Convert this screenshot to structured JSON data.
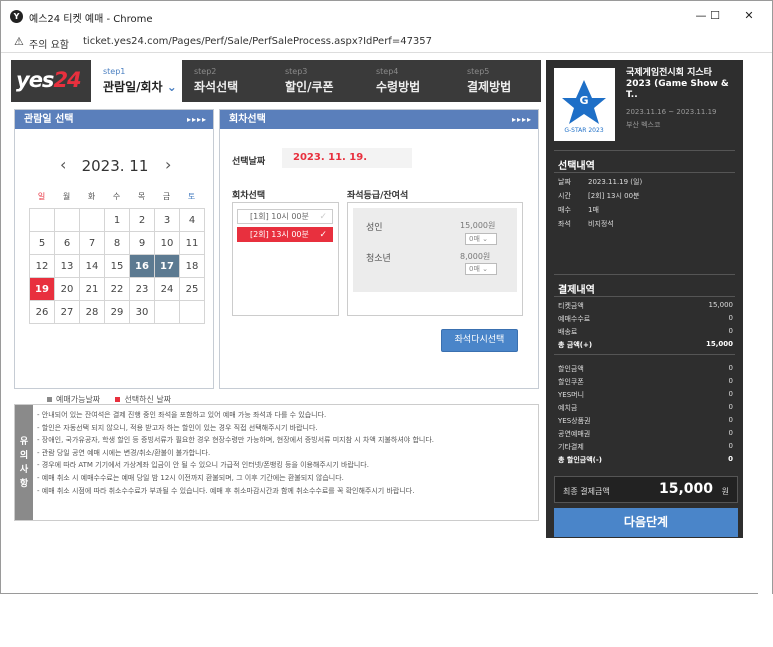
{
  "window": {
    "title": "예스24 티켓 예매 - Chrome",
    "app_icon": "Y",
    "minimize": "—",
    "maximize": "☐",
    "close": "✕"
  },
  "urlbar": {
    "warning": "주의 요함",
    "url": "ticket.yes24.com/Pages/Perf/Sale/PerfSaleProcess.aspx?IdPerf=47357"
  },
  "logo": {
    "text": "yes",
    "num": "24"
  },
  "steps": [
    {
      "num": "step1",
      "label": "관람일/회차",
      "active": true
    },
    {
      "num": "step2",
      "label": "좌석선택"
    },
    {
      "num": "step3",
      "label": "할인/쿠폰"
    },
    {
      "num": "step4",
      "label": "수령방법"
    },
    {
      "num": "step5",
      "label": "결제방법"
    }
  ],
  "date_panel": {
    "title": "관람일 선택",
    "arrows": "▸▸▸▸",
    "month": "2023. 11",
    "prev": "‹",
    "next": "›",
    "weekdays": [
      "일",
      "월",
      "화",
      "수",
      "목",
      "금",
      "토"
    ],
    "weekday_colors": [
      "#e8303e",
      "#555",
      "#555",
      "#555",
      "#555",
      "#555",
      "#4a7fc1"
    ],
    "weeks": [
      [
        "",
        "",
        "",
        "1",
        "2",
        "3",
        "4"
      ],
      [
        "5",
        "6",
        "7",
        "8",
        "9",
        "10",
        "11"
      ],
      [
        "12",
        "13",
        "14",
        "15",
        "16",
        "17",
        "18"
      ],
      [
        "19",
        "20",
        "21",
        "22",
        "23",
        "24",
        "25"
      ],
      [
        "26",
        "27",
        "28",
        "29",
        "30",
        "",
        ""
      ]
    ],
    "available": [
      "16",
      "17"
    ],
    "selected": "19",
    "legend_available": "예매가능날짜",
    "legend_selected": "선택하신 날짜",
    "legend_available_color": "#5c7a91",
    "legend_selected_color": "#e8303e"
  },
  "round_panel": {
    "title": "회차선택",
    "arrows": "▸▸▸▸",
    "selected_date_label": "선택날짜",
    "selected_date": "2023. 11. 19.",
    "round_label": "회차선택",
    "seat_label": "좌석등급/잔여석",
    "rounds": [
      {
        "label": "[1회] 10시 00분",
        "active": false
      },
      {
        "label": "[2회] 13시 00분",
        "active": true
      }
    ],
    "check": "✓",
    "grades": [
      {
        "name": "성인",
        "price": "15,000원",
        "qty": "0매"
      },
      {
        "name": "청소년",
        "price": "8,000원",
        "qty": "0매"
      }
    ],
    "reselect": "좌석다시선택"
  },
  "notice": {
    "tab": [
      "유",
      "의",
      "사",
      "항"
    ],
    "lines": [
      "- 안내되어 있는 잔여석은 결제 진행 중인 좌석을 포함하고 있어 예매 가능 좌석과 다를 수 있습니다.",
      "- 할인은 자동선택 되지 않으니, 적용 받고자 하는 할인이 있는 경우 직접 선택해주시기 바랍니다.",
      "- 장애인, 국가유공자, 학생 할인 등 증빙서류가 필요한 경우 현장수령만 가능하며, 현장에서 증빙서류 미지참 시 차액 지불하셔야 합니다.",
      "- 관람 당일 공연 예매 시에는 변경/취소/환불이 불가합니다.",
      "- 경우에 따라 ATM 기기에서 가상계좌 입금이 안 될 수 있으니 가급적 인터넷/폰뱅킹 등을 이용해주시기 바랍니다.",
      "- 예매 취소 시 예매수수료는 예매 당일 밤 12시 이전까지 환불되며, 그 이후 기간에는 환불되지 않습니다.",
      "- 예매 취소 시점에 따라 취소수수료가 부과될 수 있습니다. 예매 후 취소마감시간과 함께 취소수수료를 꼭 확인해주시기 바랍니다."
    ]
  },
  "sidebar": {
    "poster_text": "G-STAR 2023",
    "event_title": "국제게임전시회 지스타 2023 (Game Show & T..",
    "event_date": "2023.11.16 ~ 2023.11.19",
    "event_venue": "부산 벡스코",
    "selection_title": "선택내역",
    "selection": [
      {
        "k": "날짜",
        "v": "2023.11.19 (일)"
      },
      {
        "k": "시간",
        "v": "[2회] 13시 00분"
      },
      {
        "k": "매수",
        "v": "1매"
      },
      {
        "k": "좌석",
        "v": "비지정석"
      }
    ],
    "payment_title": "결제내역",
    "payment": [
      {
        "k": "티켓금액",
        "v": "15,000"
      },
      {
        "k": "예매수수료",
        "v": "0"
      },
      {
        "k": "배송료",
        "v": "0"
      },
      {
        "k": "총 금액(+)",
        "v": "15,000",
        "bold": true
      }
    ],
    "discount": [
      {
        "k": "할인금액",
        "v": "0"
      },
      {
        "k": "할인쿠폰",
        "v": "0"
      },
      {
        "k": "YES머니",
        "v": "0"
      },
      {
        "k": "예치금",
        "v": "0"
      },
      {
        "k": "YES상품권",
        "v": "0"
      },
      {
        "k": "공연예매권",
        "v": "0"
      },
      {
        "k": "기타결제",
        "v": "0"
      },
      {
        "k": "총 할인금액(-)",
        "v": "0",
        "bold": true
      }
    ],
    "final_label": "최종 결제금액",
    "final_value": "15,000",
    "final_unit": "원",
    "next": "다음단계"
  }
}
